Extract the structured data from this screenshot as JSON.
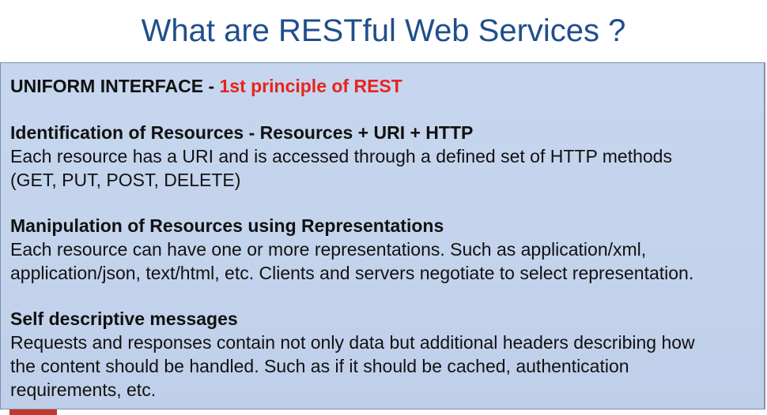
{
  "title": "What are RESTful Web Services ?",
  "heading": {
    "main": "UNIFORM INTERFACE - ",
    "highlight": "1st principle of REST",
    "highlight_color": "#e8231c"
  },
  "sections": [
    {
      "heading": "Identification of Resources - Resources + URI + HTTP",
      "lines": [
        "Each resource has a URI and is accessed through a defined set of HTTP methods",
        "(GET, PUT, POST, DELETE)"
      ]
    },
    {
      "heading": "Manipulation of Resources using Representations",
      "lines": [
        "Each resource can have one or more representations. Such as application/xml,",
        "application/json, text/html, etc. Clients and servers negotiate to select representation."
      ]
    },
    {
      "heading": "Self descriptive messages",
      "lines": [
        "Requests and responses contain not only data but additional headers describing how",
        "the content should be handled. Such as if it should be cached, authentication",
        "requirements, etc."
      ]
    }
  ],
  "colors": {
    "title": "#1f4e8c",
    "box_background": "#c4d4ed",
    "text": "#111111"
  }
}
